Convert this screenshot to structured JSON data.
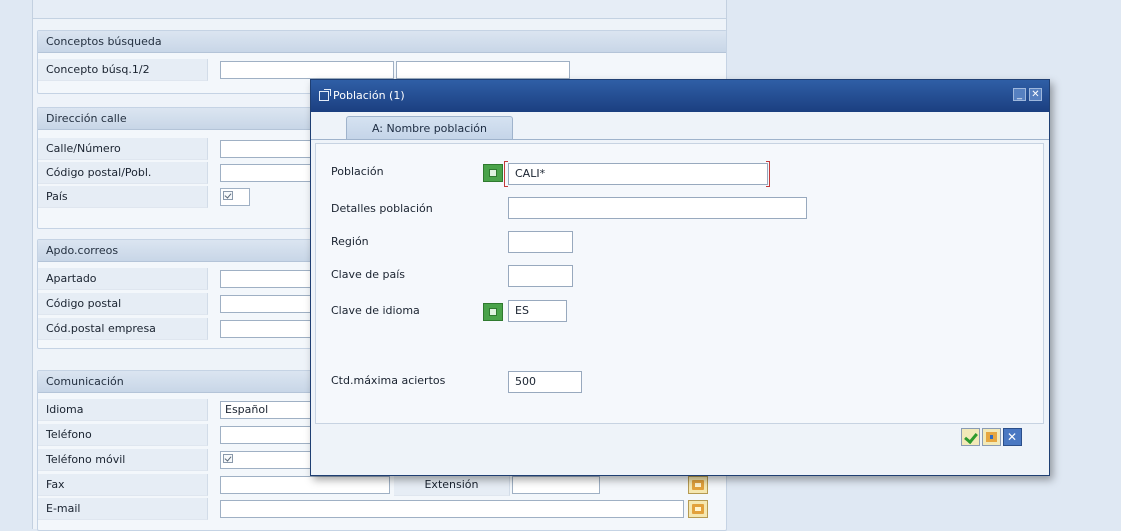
{
  "sections": {
    "conceptos": {
      "title": "Conceptos búsqueda",
      "concepto_label": "Concepto búsq.1/2",
      "concepto_value_1": "",
      "concepto_value_2": ""
    },
    "direccion": {
      "title": "Dirección calle",
      "calle_label": "Calle/Número",
      "cp_label": "Código postal/Pobl.",
      "pais_label": "País"
    },
    "apdo": {
      "title": "Apdo.correos",
      "apartado_label": "Apartado",
      "cp_label": "Código postal",
      "cp_empresa_label": "Cód.postal empresa"
    },
    "comunicacion": {
      "title": "Comunicación",
      "idioma_label": "Idioma",
      "idioma_value": "Español",
      "telefono_label": "Teléfono",
      "movil_label": "Teléfono móvil",
      "fax_label": "Fax",
      "extension_label": "Extensión",
      "email_label": "E-mail"
    }
  },
  "dialog": {
    "title": "Población (1)",
    "tab_label": "A: Nombre población",
    "fields": {
      "poblacion_label": "Población",
      "poblacion_value": "CALI*",
      "detalles_label": "Detalles población",
      "detalles_value": "",
      "region_label": "Región",
      "region_value": "",
      "clave_pais_label": "Clave de país",
      "clave_pais_value": "",
      "clave_idioma_label": "Clave de idioma",
      "clave_idioma_value": "ES",
      "max_aciertos_label": "Ctd.máxima aciertos",
      "max_aciertos_value": "500"
    },
    "buttons": [
      "continue",
      "multiple-selection",
      "cancel"
    ]
  },
  "colors": {
    "titlebar": "#1f4a8f",
    "match_icon": "#4aa34a",
    "focus_bracket": "#c33a3a"
  }
}
